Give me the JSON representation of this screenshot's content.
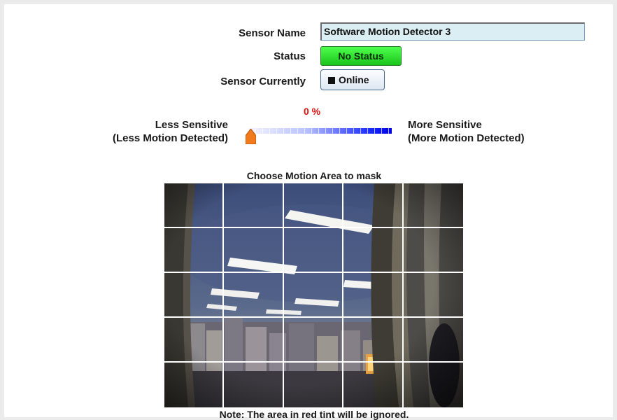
{
  "form": {
    "sensor_name_label": "Sensor Name",
    "sensor_name_value": "Software Motion Detector 3",
    "status_label": "Status",
    "status_value": "No Status",
    "sensor_currently_label": "Sensor Currently",
    "sensor_currently_value": "Online"
  },
  "sensitivity": {
    "percent": 0,
    "percent_text": "0 %",
    "less_label": "Less Sensitive",
    "less_sub": "(Less Motion Detected)",
    "more_label": "More Sensitive",
    "more_sub": "(More Motion Detected)"
  },
  "mask": {
    "caption": "Choose Motion Area to mask",
    "rows": 5,
    "cols": 5,
    "note": "Note: The area in red tint will be ignored."
  },
  "colors": {
    "status_green": "#2bd62b",
    "percent_red": "#e01010",
    "slider_blue": "#0000e0",
    "thumb_orange": "#f07a1c"
  }
}
